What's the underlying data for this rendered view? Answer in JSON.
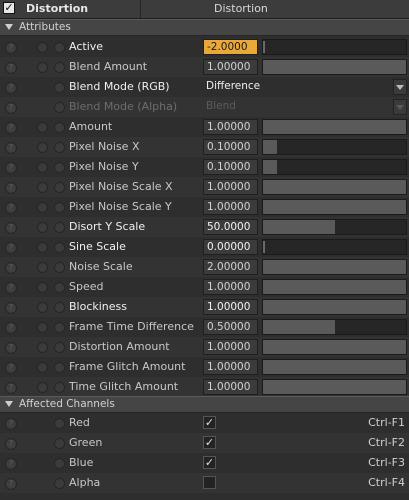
{
  "header": {
    "enabled_check": "✓",
    "name": "Distortion",
    "type": "Distortion"
  },
  "sections": {
    "attributes": "Attributes",
    "affected": "Affected Channels"
  },
  "attributes": {
    "active": {
      "label": "Active",
      "value": "-2.0000",
      "level": 0
    },
    "blend_amount": {
      "label": "Blend Amount",
      "value": "1.00000",
      "level": 1
    },
    "blend_mode_rgb": {
      "label": "Blend Mode (RGB)",
      "value": "Difference"
    },
    "blend_mode_alpha": {
      "label": "Blend Mode (Alpha)",
      "value": "Blend"
    },
    "amount": {
      "label": "Amount",
      "value": "1.00000",
      "level": 1
    },
    "pixel_noise_x": {
      "label": "Pixel Noise X",
      "value": "0.10000",
      "level": 0.1
    },
    "pixel_noise_y": {
      "label": "Pixel Noise Y",
      "value": "0.10000",
      "level": 0.1
    },
    "pixel_noise_scale_x": {
      "label": "Pixel Noise Scale X",
      "value": "1.00000",
      "level": 1
    },
    "pixel_noise_scale_y": {
      "label": "Pixel Noise Scale Y",
      "value": "1.00000",
      "level": 1
    },
    "disort_y_scale": {
      "label": "Disort Y Scale",
      "value": "50.0000",
      "level": 0.5
    },
    "sine_scale": {
      "label": "Sine Scale",
      "value": "0.00000",
      "level": 0
    },
    "noise_scale": {
      "label": "Noise Scale",
      "value": "2.00000",
      "level": 1
    },
    "speed": {
      "label": "Speed",
      "value": "1.00000",
      "level": 1
    },
    "blockiness": {
      "label": "Blockiness",
      "value": "1.00000",
      "level": 1
    },
    "frame_time_difference": {
      "label": "Frame Time Difference",
      "value": "0.50000",
      "level": 0.5
    },
    "distortion_amount": {
      "label": "Distortion Amount",
      "value": "1.00000",
      "level": 1
    },
    "frame_glitch_amount": {
      "label": "Frame Glitch Amount",
      "value": "1.00000",
      "level": 1
    },
    "time_glitch_amount": {
      "label": "Time Glitch Amount",
      "value": "1.00000",
      "level": 1
    }
  },
  "channels": [
    {
      "label": "Red",
      "checked": "✓",
      "shortcut": "Ctrl-F1"
    },
    {
      "label": "Green",
      "checked": "✓",
      "shortcut": "Ctrl-F2"
    },
    {
      "label": "Blue",
      "checked": "✓",
      "shortcut": "Ctrl-F3"
    },
    {
      "label": "Alpha",
      "checked": "",
      "shortcut": "Ctrl-F4"
    }
  ],
  "help_glyph": "?",
  "colors": {
    "active_field": "#e8a93a",
    "panel": "#2e2e2e",
    "header": "#3c3c3c"
  }
}
